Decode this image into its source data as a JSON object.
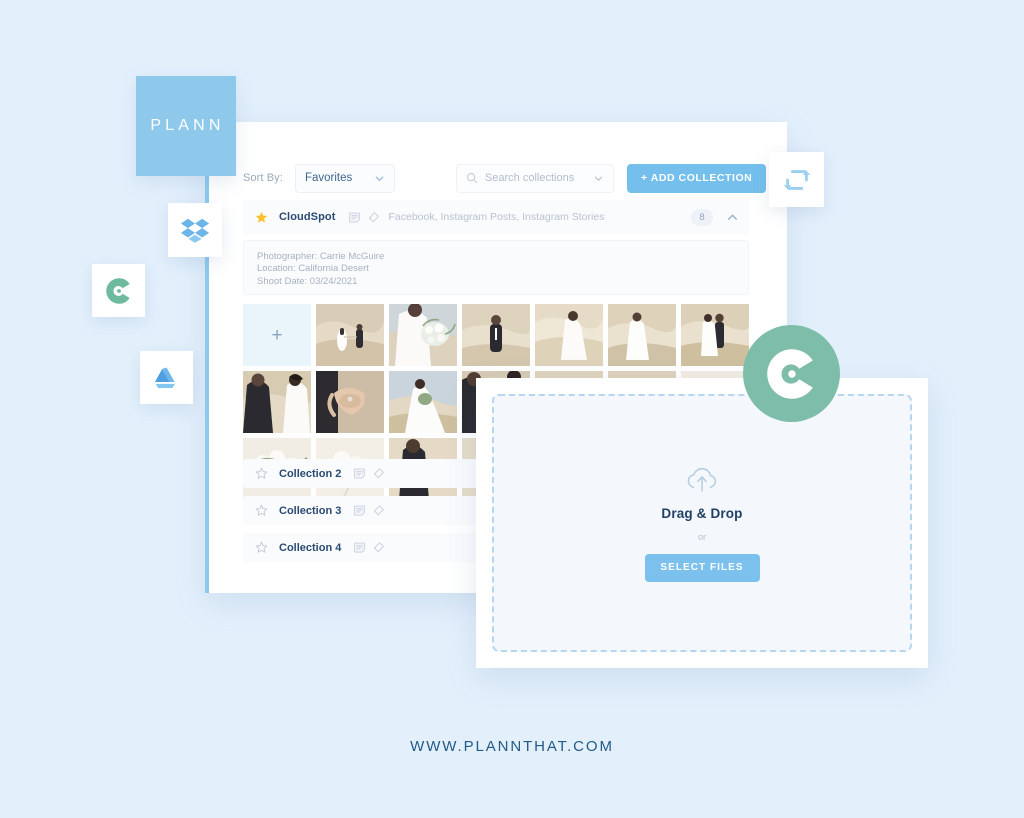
{
  "brand": {
    "tile_word": "PLANN",
    "tile_color": "#8ec9ec"
  },
  "footer": {
    "url": "WWW.PLANNTHAT.COM"
  },
  "app_tiles": [
    {
      "name": "dropbox",
      "label": "Dropbox",
      "color": "#579fe0"
    },
    {
      "name": "cloudspot",
      "label": "CloudSpot",
      "color": "#6fb99e"
    },
    {
      "name": "google-drive",
      "label": "Google Drive",
      "color": "#5aa7e8"
    },
    {
      "name": "sync",
      "label": "Sync",
      "color": "#a5d4f2"
    }
  ],
  "toolbar": {
    "sort_label": "Sort By:",
    "sort_value": "Favorites",
    "sort_options": [
      "Favorites"
    ],
    "search_placeholder": "Search collections",
    "add_collection_label": "+ ADD COLLECTION"
  },
  "collection": {
    "title": "CloudSpot",
    "favorited": true,
    "tags": "Facebook, Instagram Posts, Instagram Stories",
    "count": "8",
    "expanded": true,
    "meta": {
      "photographer": "Photographer: Carrie McGuire",
      "location": "Location: California Desert",
      "shoot_date": "Shoot Date: 03/24/2021"
    },
    "add_tile_glyph": "+"
  },
  "collection_rows": [
    {
      "name": "Collection 2",
      "favorited": false
    },
    {
      "name": "Collection 3",
      "favorited": false
    },
    {
      "name": "Collection 4",
      "favorited": false
    }
  ],
  "upload_modal": {
    "drag_drop_label": "Drag & Drop",
    "or_label": "or",
    "select_files_label": "SELECT FILES"
  },
  "colors": {
    "background": "#e3f0fc",
    "accent_blue": "#74bfec",
    "brand_blue": "#8ec9ec",
    "cloudspot_green": "#7ebda9",
    "text_navy": "#2b4a73",
    "star_gold": "#fdc02f"
  }
}
